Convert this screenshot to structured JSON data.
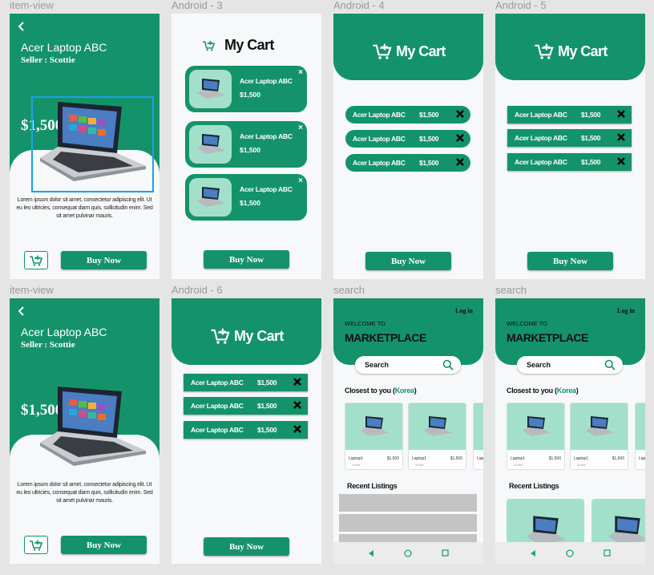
{
  "frames": {
    "f1": {
      "label": "item-view"
    },
    "f2": {
      "label": "Android - 3"
    },
    "f3": {
      "label": "Android - 4"
    },
    "f4": {
      "label": "Android - 5"
    },
    "f5": {
      "label": "item-view"
    },
    "f6": {
      "label": "Android - 6"
    },
    "f7": {
      "label": "search"
    },
    "f8": {
      "label": "search"
    }
  },
  "item": {
    "name": "Acer Laptop ABC",
    "seller": "Seller : Scottie",
    "price": "$1,500",
    "description": "Lorem ipsum dolor sit amet, consectetur adipiscing elit. Ut eu leo ultricies, consequat diam quis, sollicitudin enim. Sed sit amet pulvinar mauris.",
    "buy_label": "Buy Now"
  },
  "cart": {
    "title": "My Cart",
    "item_name": "Acer Laptop ABC",
    "item_price": "$1,500",
    "remove_glyph": "✕",
    "close_glyph": "×",
    "buy_label": "Buy Now"
  },
  "search": {
    "login": "Log in",
    "welcome": "WELCOME TO",
    "brand": "MARKETPLACE",
    "placeholder": "Search",
    "closest_prefix": "Closest to you (",
    "closest_region": "Korea",
    "closest_suffix": ")",
    "recent": "Recent Listings",
    "product_name": "Laptop1",
    "product_price": "$1,500",
    "product_seller": "Scottie"
  },
  "colors": {
    "brand": "#14936a",
    "mint": "#a3e0cb"
  },
  "icons": {
    "back": "chevron-left-icon",
    "cart": "cart-plus-icon",
    "search": "search-icon",
    "remove": "close-icon"
  }
}
